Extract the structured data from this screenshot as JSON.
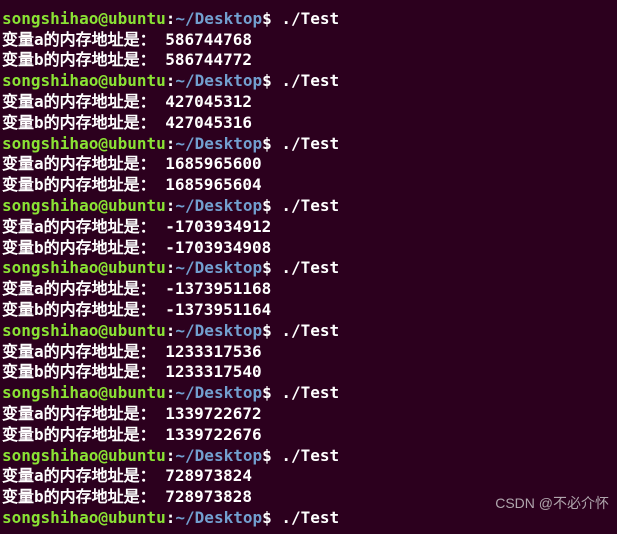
{
  "prompt": {
    "user_host": "songshihao@ubuntu",
    "colon": ":",
    "path": "~/Desktop",
    "dollar": "$",
    "command": " ./Test"
  },
  "labels": {
    "line_a_prefix": "变量a的内存地址是：",
    "line_b_prefix": "变量b的内存地址是："
  },
  "runs": [
    {
      "a": " 586744768",
      "b": " 586744772"
    },
    {
      "a": " 427045312",
      "b": " 427045316"
    },
    {
      "a": " 1685965600",
      "b": " 1685965604"
    },
    {
      "a": " -1703934912",
      "b": " -1703934908"
    },
    {
      "a": " -1373951168",
      "b": " -1373951164"
    },
    {
      "a": " 1233317536",
      "b": " 1233317540"
    },
    {
      "a": " 1339722672",
      "b": " 1339722676"
    },
    {
      "a": " 728973824",
      "b": " 728973828"
    }
  ],
  "watermark": "CSDN @不必介怀"
}
